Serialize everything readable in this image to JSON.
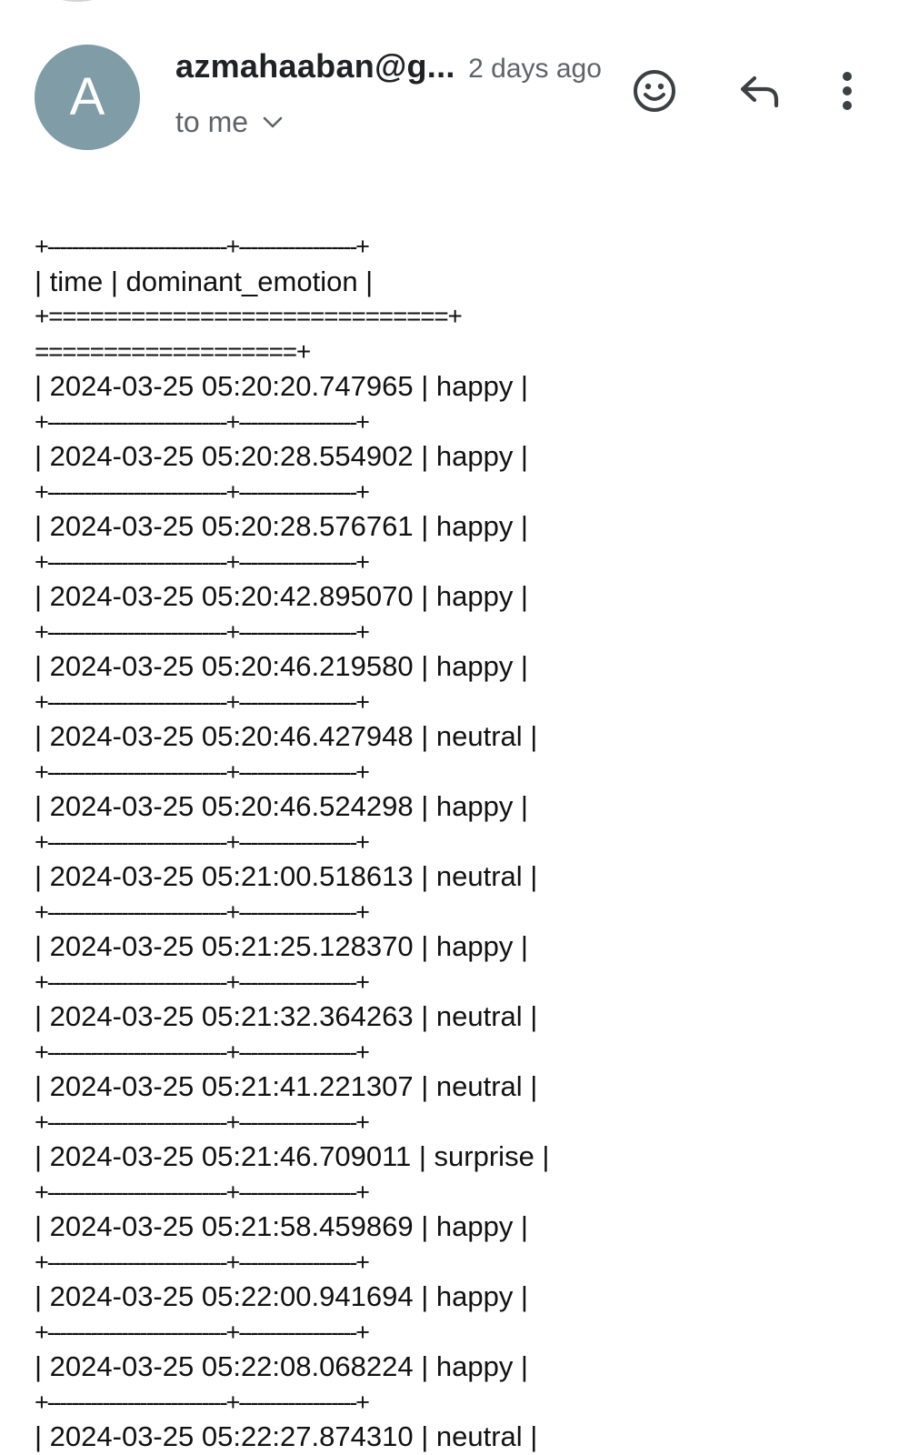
{
  "message": {
    "avatar_letter": "A",
    "sender": "azmahaaban@g...",
    "time_ago": "2 days ago",
    "recipient": "to me"
  },
  "icons": {
    "emoji": "smiley-icon",
    "reply": "reply-icon",
    "more": "more-vert-icon",
    "expand": "chevron-down-icon"
  },
  "body": {
    "lines": [
      "+-----------------------------+-------------------+",
      "| time | dominant_emotion |",
      "+=============================+",
      "===================+",
      "| 2024-03-25 05:20:20.747965 | happy |",
      "+-----------------------------+-------------------+",
      "| 2024-03-25 05:20:28.554902 | happy |",
      "+-----------------------------+-------------------+",
      "| 2024-03-25 05:20:28.576761 | happy |",
      "+-----------------------------+-------------------+",
      "| 2024-03-25 05:20:42.895070 | happy |",
      "+-----------------------------+-------------------+",
      "| 2024-03-25 05:20:46.219580 | happy |",
      "+-----------------------------+-------------------+",
      "| 2024-03-25 05:20:46.427948 | neutral |",
      "+-----------------------------+-------------------+",
      "| 2024-03-25 05:20:46.524298 | happy |",
      "+-----------------------------+-------------------+",
      "| 2024-03-25 05:21:00.518613 | neutral |",
      "+-----------------------------+-------------------+",
      "| 2024-03-25 05:21:25.128370 | happy |",
      "+-----------------------------+-------------------+",
      "| 2024-03-25 05:21:32.364263 | neutral |",
      "+-----------------------------+-------------------+",
      "| 2024-03-25 05:21:41.221307 | neutral |",
      "+-----------------------------+-------------------+",
      "| 2024-03-25 05:21:46.709011 | surprise |",
      "+-----------------------------+-------------------+",
      "| 2024-03-25 05:21:58.459869 | happy |",
      "+-----------------------------+-------------------+",
      "| 2024-03-25 05:22:00.941694 | happy |",
      "+-----------------------------+-------------------+",
      "| 2024-03-25 05:22:08.068224 | happy |",
      "+-----------------------------+-------------------+",
      "| 2024-03-25 05:22:27.874310 | neutral |"
    ]
  },
  "colors": {
    "avatar_bg": "#7f9ca7",
    "text_primary": "#202124",
    "text_secondary": "#5f6368",
    "icon": "#3c4043"
  }
}
